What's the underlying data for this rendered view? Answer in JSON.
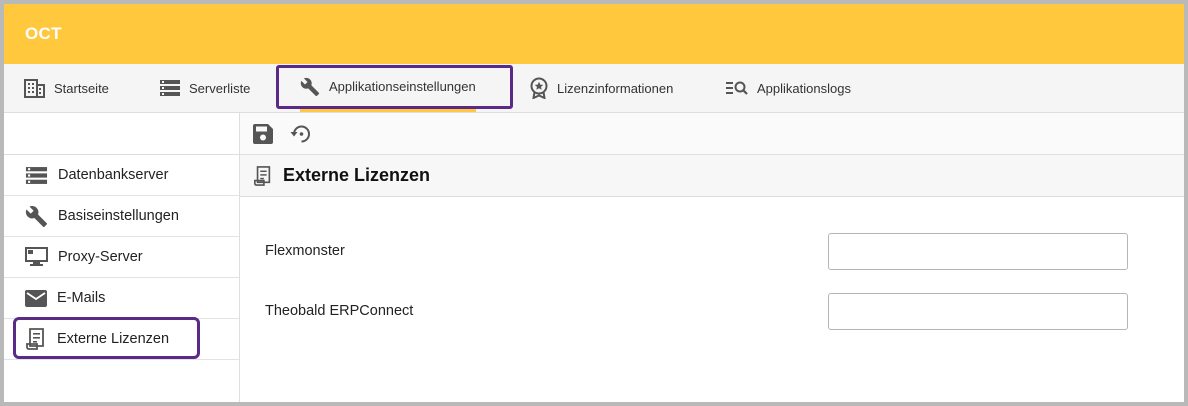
{
  "app": {
    "title": "OCT"
  },
  "nav": {
    "items": [
      {
        "label": "Startseite",
        "icon": "building-icon"
      },
      {
        "label": "Serverliste",
        "icon": "server-list-icon"
      },
      {
        "label": "Applikationseinstellungen",
        "icon": "wrench-icon",
        "active": true
      },
      {
        "label": "Lizenzinformationen",
        "icon": "award-icon"
      },
      {
        "label": "Applikationslogs",
        "icon": "log-search-icon"
      }
    ]
  },
  "sidebar": {
    "items": [
      {
        "label": "Datenbankserver",
        "icon": "server-list-icon"
      },
      {
        "label": "Basiseinstellungen",
        "icon": "wrench-icon"
      },
      {
        "label": "Proxy-Server",
        "icon": "monitor-icon"
      },
      {
        "label": "E-Mails",
        "icon": "mail-icon"
      },
      {
        "label": "Externe Lizenzen",
        "icon": "license-icon",
        "active": true
      }
    ]
  },
  "toolbar": {
    "save_icon": "save-icon",
    "reset_icon": "restore-icon"
  },
  "section": {
    "title": "Externe Lizenzen",
    "icon": "license-icon"
  },
  "form": {
    "fields": [
      {
        "label": "Flexmonster",
        "value": ""
      },
      {
        "label": "Theobald ERPConnect",
        "value": ""
      }
    ]
  },
  "colors": {
    "accent": "#ffc83d",
    "highlight": "#5b2a86",
    "icon": "#555555"
  }
}
